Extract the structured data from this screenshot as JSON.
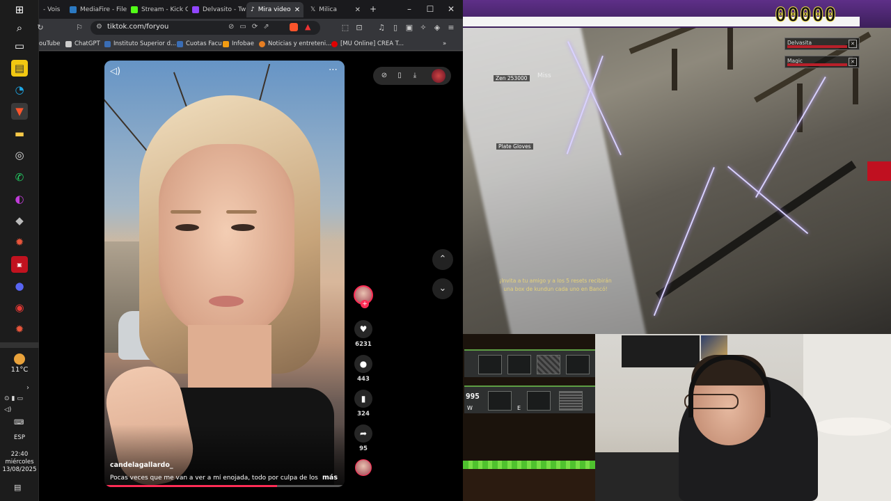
{
  "taskbar": {
    "icons": [
      "windows-icon",
      "search-icon",
      "task-view-icon",
      "notes-icon",
      "edge-icon",
      "brave-icon",
      "file-explorer-icon",
      "obs-icon",
      "whatsapp-icon",
      "app-icon",
      "cube-icon",
      "game-icon",
      "news-icon",
      "discord-icon",
      "record-icon",
      "game-icon-2"
    ],
    "temperature": "11°C",
    "language": "ESP",
    "time": "22:40",
    "day": "miércoles",
    "date": "13/08/2025"
  },
  "browser": {
    "tabs": [
      {
        "label": "- Vois",
        "color": "#888888"
      },
      {
        "label": "MediaFire - File",
        "color": "#2b79c2"
      },
      {
        "label": "Stream - Kick O",
        "color": "#53fc18"
      },
      {
        "label": "Delvasito - Twi",
        "color": "#9146ff"
      },
      {
        "label": "Mira video",
        "color": "#ffffff",
        "active": true
      },
      {
        "label": "Milica",
        "color": "#ffffff"
      }
    ],
    "url": "tiktok.com/foryou",
    "bookmarks": [
      {
        "label": "ouTube",
        "color": "#ff0000"
      },
      {
        "label": "ChatGPT",
        "color": "#cccccc"
      },
      {
        "label": "Instituto Superior d...",
        "color": "#3a6db5"
      },
      {
        "label": "Cuotas Facu",
        "color": "#3a6db5"
      },
      {
        "label": "Infobae",
        "color": "#f39c12"
      },
      {
        "label": "Noticias y entreteni...",
        "color": "#e67e22"
      },
      {
        "label": "[MU Online] CREA T...",
        "color": "#e00000"
      }
    ]
  },
  "tiktok": {
    "author": "candelagallardo_",
    "caption": "Pocas veces que me van a ver a mí enojada, todo por culpa de los ...",
    "more": "más",
    "progress": 0.72,
    "likes": "6231",
    "comments": "443",
    "saves": "324",
    "shares": "95"
  },
  "game": {
    "score": "00000",
    "party": [
      {
        "name": "Delvasita"
      },
      {
        "name": "Magic"
      }
    ],
    "labels": {
      "zen": "Zen 253000",
      "miss": "Miss",
      "item": "Plate Gloves"
    },
    "message_line1": "¡Invita a tu amigo y a los 5 resets recibirán",
    "message_line2": "una box de kundun cada uno en Bancó!"
  },
  "inventory": {
    "count": "995",
    "row1_letter": "E",
    "row2_letters": [
      "W",
      "E"
    ]
  }
}
